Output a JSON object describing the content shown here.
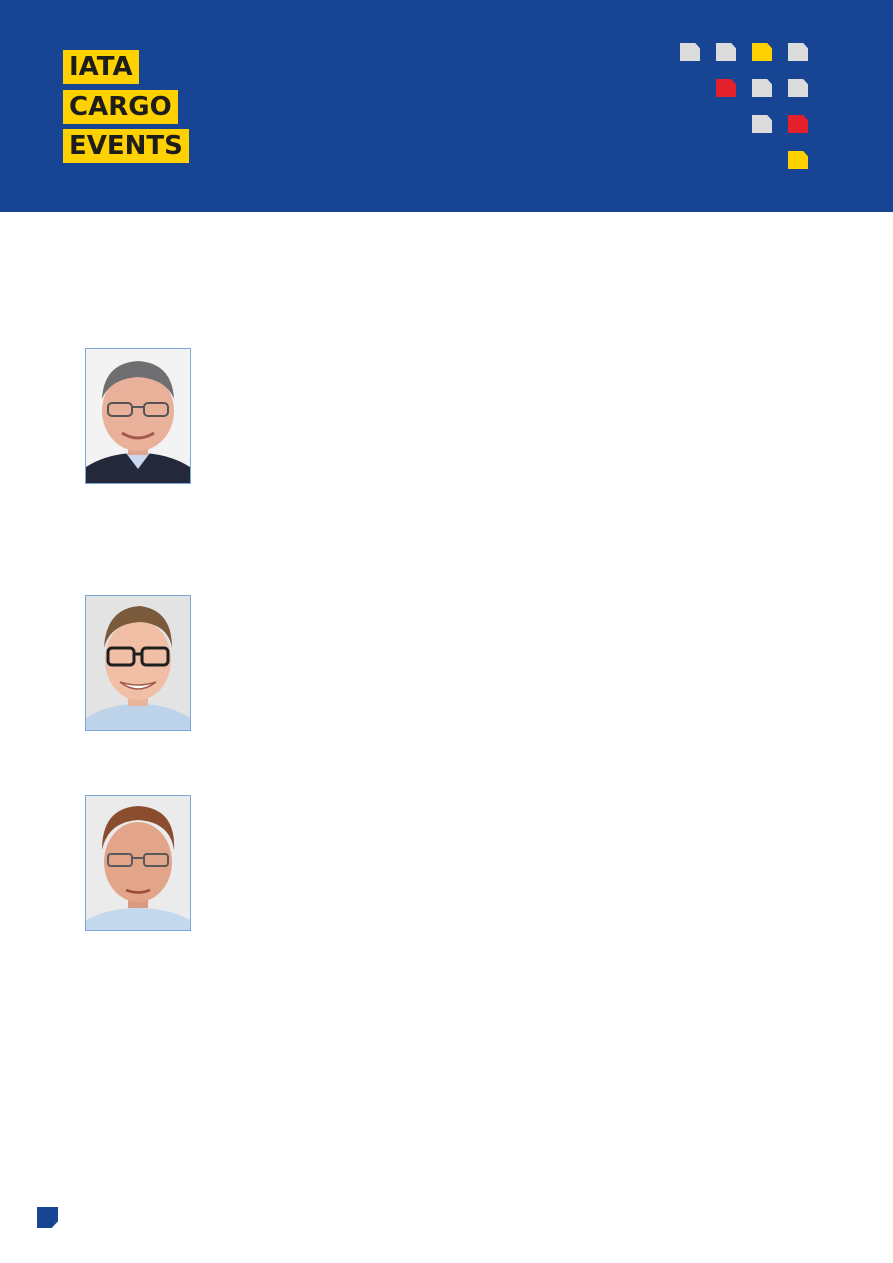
{
  "logo": {
    "lines": [
      "IATA",
      "CARGO",
      "EVENTS"
    ]
  },
  "colors": {
    "brand_blue": "#174593",
    "brand_yellow": "#ffd100",
    "accent_red": "#e4202a",
    "square_grey": "#dcdcdc",
    "photo_border": "#7aa9d9"
  },
  "decoration": {
    "squares": [
      "grey",
      "grey",
      "yellow",
      "grey",
      "red",
      "grey",
      "grey",
      "grey",
      "red",
      "yellow"
    ]
  },
  "speakers": [
    {
      "photo": "speaker-photo-1"
    },
    {
      "photo": "speaker-photo-2"
    },
    {
      "photo": "speaker-photo-3"
    }
  ]
}
